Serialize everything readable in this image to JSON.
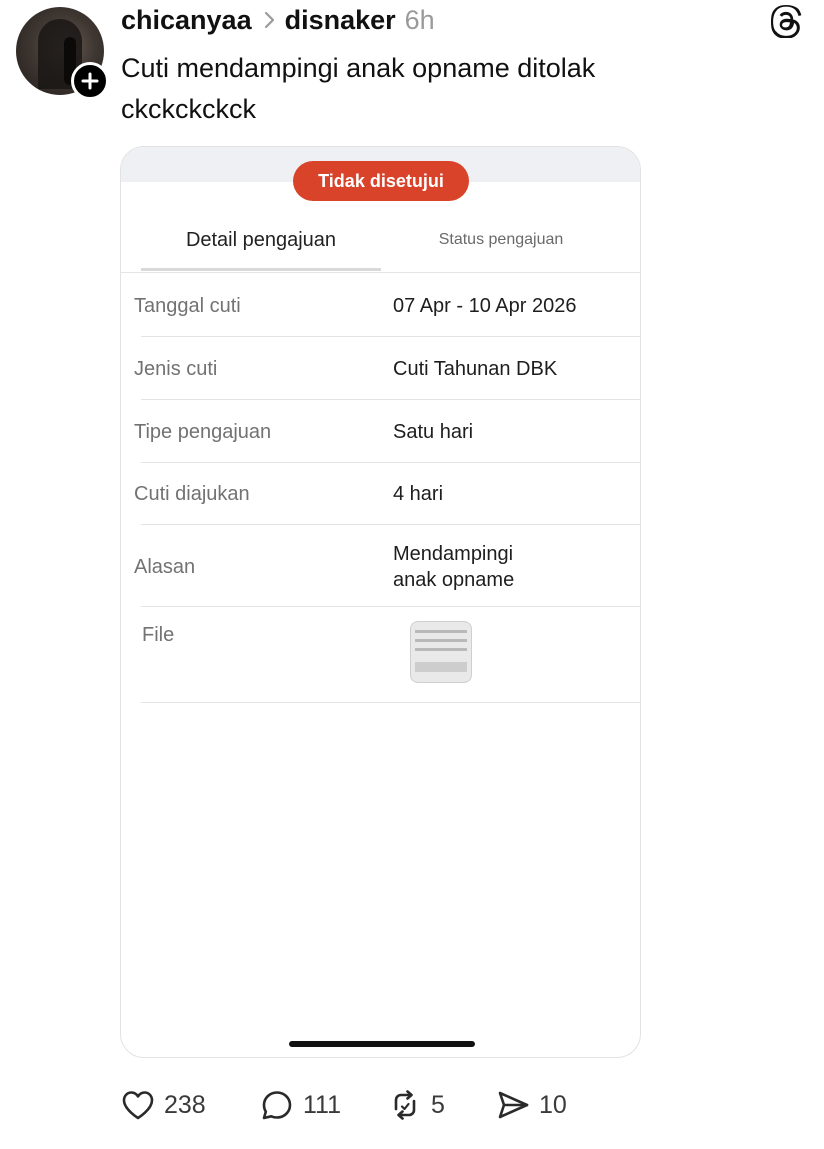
{
  "post": {
    "username": "chicanyaa",
    "community": "disnaker",
    "time": "6h",
    "text_line1": "Cuti mendampingi anak opname ditolak",
    "text_line2": "ckckckckck"
  },
  "icons": {
    "avatar": "avatar-photo",
    "follow": "plus-icon",
    "separator": "chevron-right-icon",
    "app": "threads-logo-icon",
    "like": "heart-icon",
    "reply": "comment-icon",
    "repost": "repost-icon",
    "share": "send-icon"
  },
  "card": {
    "status_badge": "Tidak disetujui",
    "tab_detail": "Detail pengajuan",
    "tab_status": "Status pengajuan",
    "rows": [
      {
        "label": "Tanggal cuti",
        "value": "07 Apr - 10 Apr 2026"
      },
      {
        "label": "Jenis cuti",
        "value": "Cuti Tahunan DBK"
      },
      {
        "label": "Tipe pengajuan",
        "value": "Satu hari"
      },
      {
        "label": "Cuti diajukan",
        "value": "4 hari"
      },
      {
        "label": "Alasan",
        "value_line1": "Mendampingi",
        "value_line2": "anak opname"
      },
      {
        "label": "File"
      }
    ]
  },
  "actions": {
    "likes": "238",
    "replies": "111",
    "reposts": "5",
    "shares": "10"
  },
  "colors": {
    "status_red": "#d9432a",
    "muted_text": "#9a9a9a"
  }
}
